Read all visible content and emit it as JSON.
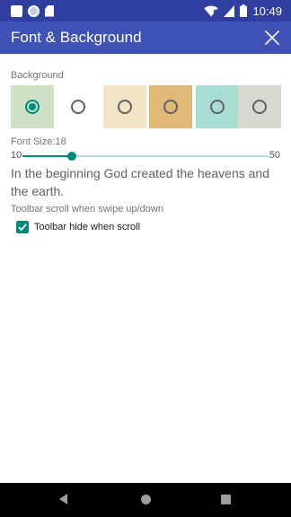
{
  "status_bar": {
    "time": "10:49",
    "left_icons": [
      "notification-square-icon",
      "notification-circle-icon",
      "sd-card-icon"
    ],
    "right_icons": [
      "wifi-icon",
      "cell-signal-icon",
      "battery-icon"
    ]
  },
  "dialog": {
    "title": "Font & Background",
    "close_icon": "close-icon"
  },
  "background": {
    "label": "Background",
    "selected_index": 0,
    "swatches": [
      {
        "id": "green-texture",
        "color": "#cfe0c4",
        "checked": true
      },
      {
        "id": "white",
        "color": "#ffffff",
        "checked": false
      },
      {
        "id": "cream-texture",
        "color": "#f3e4c8",
        "checked": false
      },
      {
        "id": "tan-texture",
        "color": "#e0b878",
        "checked": false
      },
      {
        "id": "teal-texture",
        "color": "#a8ddd3",
        "checked": false
      },
      {
        "id": "gray-texture",
        "color": "#d8d8d0",
        "checked": false
      }
    ]
  },
  "font_size": {
    "label": "Font Size:18",
    "value": 18,
    "min": 10,
    "max": 50,
    "min_label": "10",
    "max_label": "50"
  },
  "sample_text": "In the beginning God created the heavens and the earth.",
  "toolbar": {
    "label": "Toolbar scroll when swipe up/down",
    "checkbox_label": "Toolbar hide when scroll",
    "checked": true
  },
  "nav_bar": {
    "icons": [
      "back-icon",
      "home-icon",
      "recent-apps-icon"
    ]
  },
  "colors": {
    "status_bar": "#303f9f",
    "app_bar": "#3f51b5",
    "accent": "#00897b"
  }
}
